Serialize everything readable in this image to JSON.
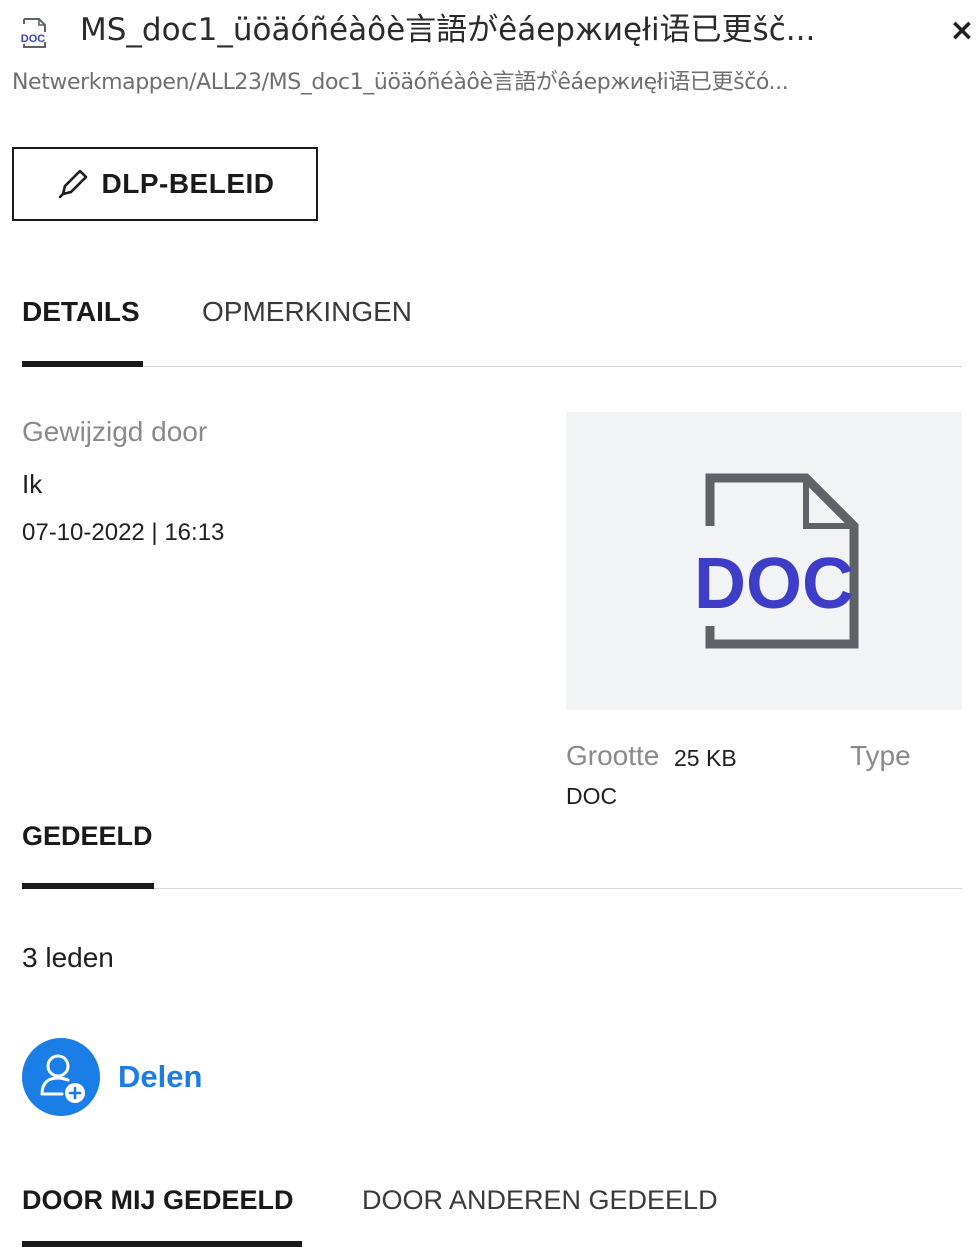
{
  "header": {
    "file_type_icon": "doc-file-icon",
    "file_type_icon_text": "DOC",
    "title": "MS_doc1_üöäóñéàôè言語がêáержиęłi语已更šč...",
    "close_label": "×",
    "breadcrumb": "Netwerkmappen/ALL23/MS_doc1_üöäóñéàôè言語がêáержиęłi语已更ščó..."
  },
  "actions": {
    "dlp_label": "DLP-BELEID",
    "dlp_icon": "pencil-icon"
  },
  "tabs": [
    {
      "label": "DETAILS",
      "active": true
    },
    {
      "label": "OPMERKINGEN",
      "active": false
    }
  ],
  "details": {
    "modified_by_label": "Gewijzigd door",
    "modified_by_value": "Ik",
    "modified_date": "07-10-2022 | 16:13",
    "preview_text": "DOC",
    "size_label": "Grootte",
    "size_value": "25 KB",
    "type_label": "Type",
    "type_value": "DOC"
  },
  "shared": {
    "title": "GEDEELD",
    "members": "3 leden",
    "share_label": "Delen",
    "share_icon": "add-user-icon"
  },
  "subtabs": [
    {
      "label": "DOOR MIJ GEDEELD",
      "active": true
    },
    {
      "label": "DOOR ANDEREN GEDEELD",
      "active": false
    }
  ],
  "colors": {
    "accent": "#1a7ee6",
    "doc_text": "#3d3dc8",
    "doc_outline": "#5f6368",
    "preview_bg": "#f2f3f4",
    "muted_text": "#8a8a8a"
  }
}
